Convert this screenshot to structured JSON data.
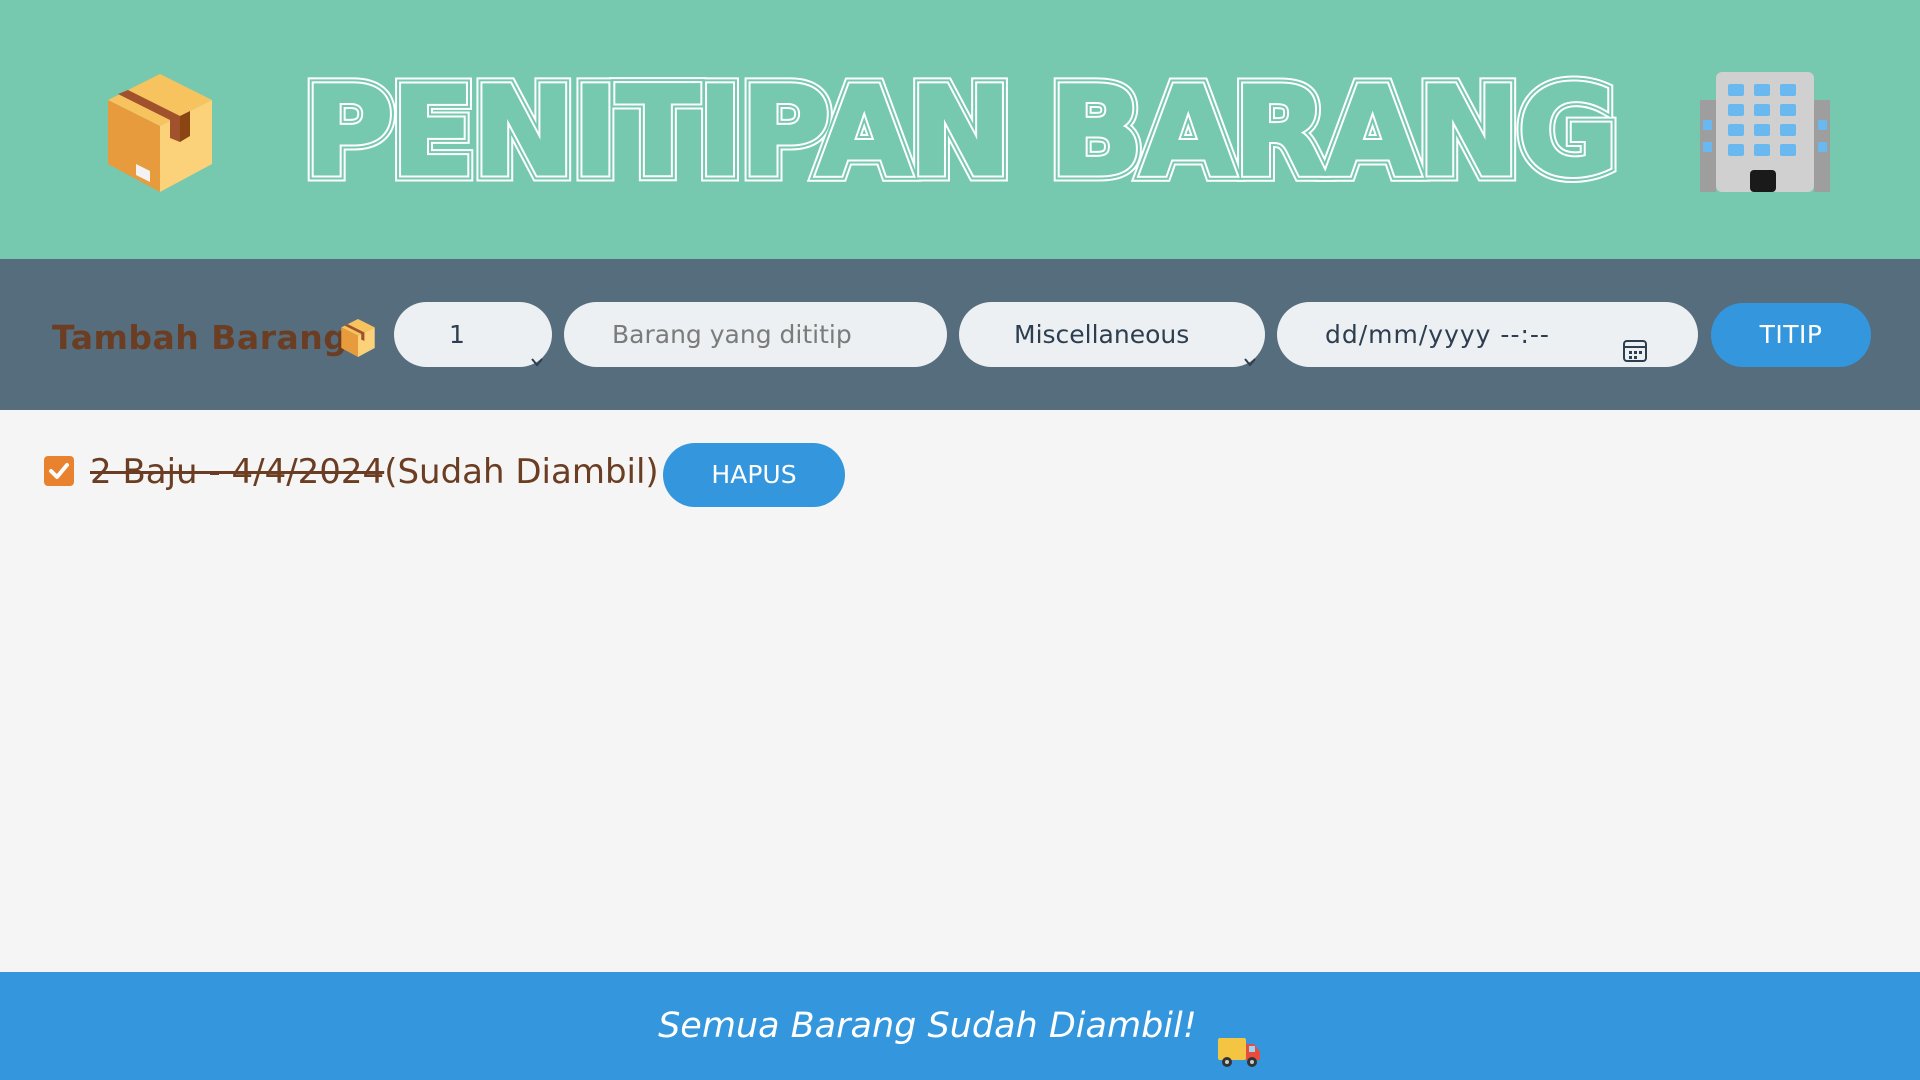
{
  "header": {
    "title": "PENITIPAN BARANG",
    "left_icon": "package-icon",
    "right_icon": "office-building-icon"
  },
  "form": {
    "label": "Tambah Barang",
    "label_icon": "package-icon",
    "quantity_value": "1",
    "item_placeholder": "Barang yang dititip",
    "category_value": "Miscellaneous",
    "datetime_placeholder": "dd/mm/yyyy --:--",
    "submit_label": "TITIP"
  },
  "items": [
    {
      "checked": true,
      "text": "2 Baju - 4/4/2024",
      "status": "(Sudah Diambil)",
      "delete_label": "HAPUS"
    }
  ],
  "footer": {
    "message": "Semua Barang Sudah Diambil!",
    "icon": "delivery-truck-icon"
  },
  "colors": {
    "header_bg": "#76c8ae",
    "formbar_bg": "#566d7e",
    "accent_blue": "#3496dc",
    "label_brown": "#6b3d22",
    "checkbox_orange": "#e8822f",
    "page_bg": "#f5f5f5"
  }
}
